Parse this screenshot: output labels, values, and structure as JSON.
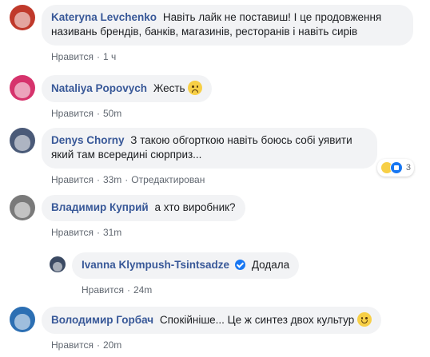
{
  "comments": [
    {
      "author": "Kateryna Levchenko",
      "text": "Навіть лайк не поставиш! І це продовження називань брендів, банків, магазинів, ресторанів і навіть сирів",
      "like_label": "Нравится",
      "time": "1 ч",
      "avatar_color": "#c0392b"
    },
    {
      "author": "Nataliya Popovych",
      "text": "Жесть",
      "like_label": "Нравится",
      "time": "50m",
      "avatar_color": "#d6336c",
      "emoji_icon": "sad-face-icon"
    },
    {
      "author": "Denys Chorny",
      "text": "З такою обгорткою навіть боюсь собі уявити який там всередині сюрприз...",
      "like_label": "Нравится",
      "time": "33m",
      "edited": "Отредактирован",
      "avatar_color": "#4a5a78",
      "reactions": {
        "icons": [
          "haha-reaction-icon",
          "like-reaction-icon"
        ],
        "count": "3"
      }
    },
    {
      "author": "Владимир Куприй",
      "text": "а хто виробник?",
      "like_label": "Нравится",
      "time": "31m",
      "avatar_color": "#7a7a7a"
    },
    {
      "author": "Ivanna Klympush-Tsintsadze",
      "text": "Додала",
      "like_label": "Нравится",
      "time": "24m",
      "avatar_color": "#3b4a63",
      "verified_icon": "verified-badge-icon",
      "is_reply": true
    },
    {
      "author": "Володимир Горбач",
      "text": "Спокійніше... Це ж синтез двох культур",
      "like_label": "Нравится",
      "time": "20m",
      "avatar_color": "#2c6fb3",
      "emoji_icon": "smile-face-icon"
    }
  ]
}
